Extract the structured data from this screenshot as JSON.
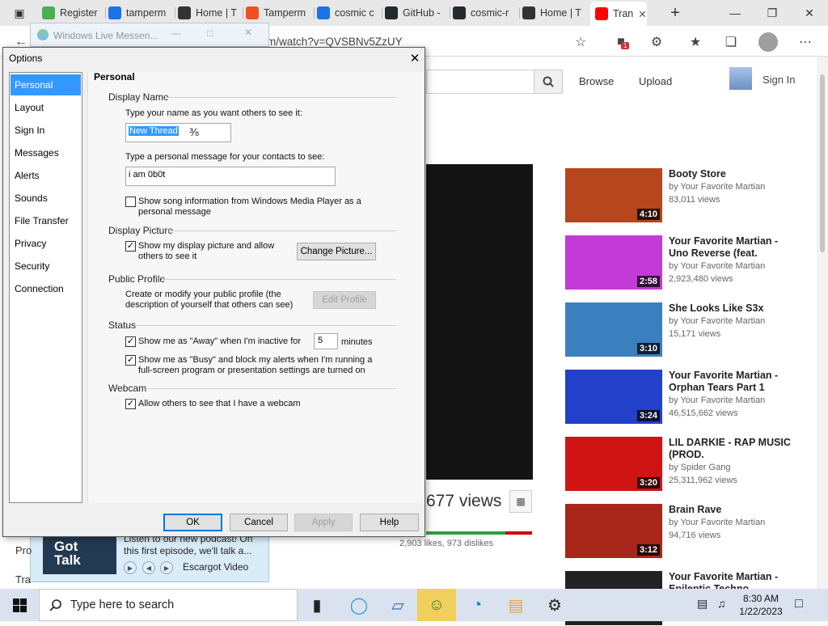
{
  "browser": {
    "tabs": [
      {
        "label": "Register",
        "color": "#4caf50"
      },
      {
        "label": "tamperm",
        "color": "#1a73e8"
      },
      {
        "label": "Home | T",
        "color": "#333333"
      },
      {
        "label": "Tamperm",
        "color": "#f25022"
      },
      {
        "label": "cosmic c",
        "color": "#1a73e8"
      },
      {
        "label": "GitHub -",
        "color": "#24292e"
      },
      {
        "label": "cosmic-r",
        "color": "#24292e"
      },
      {
        "label": "Home | T",
        "color": "#333333"
      },
      {
        "label": "Tran",
        "color": "#ff0000"
      }
    ],
    "new_tab": "+",
    "url": "m/watch?v=QVSBNv5ZzUY",
    "extension_badge": "1"
  },
  "youtube": {
    "browse": "Browse",
    "upload": "Upload",
    "sign_in": "Sign In",
    "views": "677 views",
    "likes": "2,903 likes, 973 dislikes",
    "like_ratio": 0.75,
    "recommendations": [
      {
        "title": "Booty Store",
        "channel": "by Your Favorite Martian",
        "views": "83,011 views",
        "duration": "4:10",
        "thumb": "#b5461d"
      },
      {
        "title": "Your Favorite Martian - Uno Reverse (feat.",
        "channel": "by Your Favorite Martian",
        "views": "2,923,480 views",
        "duration": "2:58",
        "thumb": "#c23bd6"
      },
      {
        "title": "She Looks Like S3x",
        "channel": "by Your Favorite Martian",
        "views": "15,171 views",
        "duration": "3:10",
        "thumb": "#3c7fbf"
      },
      {
        "title": "Your Favorite Martian - Orphan Tears Part 1",
        "channel": "by Your Favorite Martian",
        "views": "46,515,662 views",
        "duration": "3:24",
        "thumb": "#2240c9"
      },
      {
        "title": "LIL DARKIE - RAP MUSIC (PROD.",
        "channel": "by Spider Gang",
        "views": "25,311,962 views",
        "duration": "3:20",
        "thumb": "#d01414"
      },
      {
        "title": "Brain Rave",
        "channel": "by Your Favorite Martian",
        "views": "94,716 views",
        "duration": "3:12",
        "thumb": "#a8261a"
      },
      {
        "title": "Your Favorite Martian - Epileptic Techno",
        "channel": "",
        "views": "",
        "duration": "",
        "thumb": "#222222"
      }
    ]
  },
  "messenger": {
    "window_title": "Windows Live Messen...",
    "podcast_text": "Listen to our new podcast! On this first episode, we'll talk a...",
    "podcast_source": "Escargot Video",
    "podcast_thumb_text": "Got Talk",
    "left_fragments": [
      "Pro",
      "Tra"
    ]
  },
  "options": {
    "title": "Options",
    "categories": [
      "Personal",
      "Layout",
      "Sign In",
      "Messages",
      "Alerts",
      "Sounds",
      "File Transfer",
      "Privacy",
      "Security",
      "Connection"
    ],
    "selected_category": "Personal",
    "heading": "Personal",
    "display_name": {
      "section": "Display Name",
      "prompt": "Type your name as you want others to see it:",
      "value": "New Thread",
      "personal_prompt": "Type a personal message for your contacts to see:",
      "personal_value": "i am 0b0t",
      "song_info": "Show song information from Windows Media Player as a personal message",
      "song_checked": false
    },
    "display_picture": {
      "section": "Display Picture",
      "show_label": "Show my display picture and allow others to see it",
      "show_checked": true,
      "change_button": "Change Picture..."
    },
    "public_profile": {
      "section": "Public Profile",
      "description": "Create or modify your public profile (the description of yourself that others can see)",
      "edit_button": "Edit Profile"
    },
    "status": {
      "section": "Status",
      "away_label": "Show me as \"Away\" when I'm inactive for",
      "away_checked": true,
      "away_minutes": "5",
      "minutes_label": "minutes",
      "busy_label": "Show me as \"Busy\" and block my alerts when I'm running a full-screen program or presentation settings are turned on",
      "busy_checked": true
    },
    "webcam": {
      "section": "Webcam",
      "allow_label": "Allow others to see that I have a webcam",
      "allow_checked": true
    },
    "buttons": {
      "ok": "OK",
      "cancel": "Cancel",
      "apply": "Apply",
      "help": "Help"
    }
  },
  "taskbar": {
    "search_placeholder": "Type here to search",
    "time": "8:30 AM",
    "date": "1/22/2023"
  }
}
